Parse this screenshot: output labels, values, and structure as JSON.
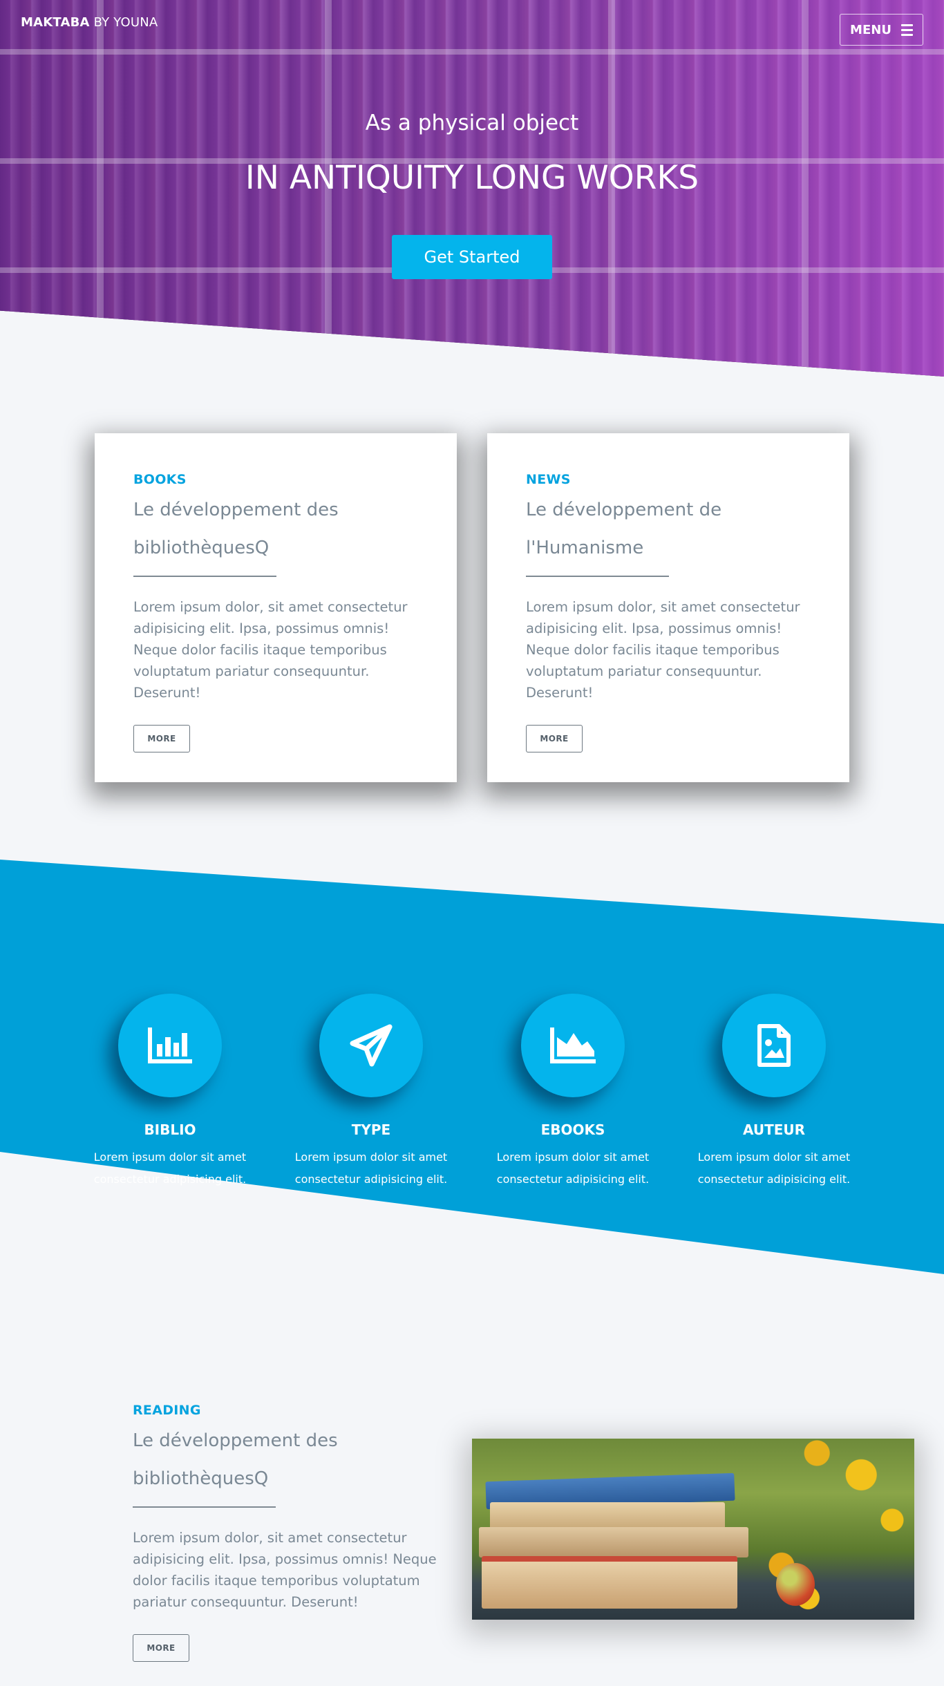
{
  "header": {
    "brand_bold": "MAKTABA",
    "brand_rest": " BY YOUNA",
    "menu_label": "MENU"
  },
  "hero": {
    "subtitle": "As a physical object",
    "title": "IN ANTIQUITY LONG WORKS",
    "cta_label": "Get Started"
  },
  "cards": [
    {
      "kicker": "BOOKS",
      "title_line1": "Le développement des",
      "title_line2": "bibliothèquesQ",
      "text": "Lorem ipsum dolor, sit amet consectetur adipisicing elit. Ipsa, possimus omnis! Neque dolor facilis itaque temporibus voluptatum pariatur consequuntur. Deserunt!",
      "button": "MORE"
    },
    {
      "kicker": "NEWS",
      "title_line1": "Le développement de",
      "title_line2": "l'Humanisme",
      "text": "Lorem ipsum dolor, sit amet consectetur adipisicing elit. Ipsa, possimus omnis! Neque dolor facilis itaque temporibus voluptatum pariatur consequuntur. Deserunt!",
      "button": "MORE"
    }
  ],
  "features": [
    {
      "icon": "bar-chart-icon",
      "title": "BIBLIO",
      "line1": "Lorem ipsum dolor sit amet",
      "line2": "consectetur adipisicing elit."
    },
    {
      "icon": "paper-plane-icon",
      "title": "TYPE",
      "line1": "Lorem ipsum dolor sit amet",
      "line2": "consectetur adipisicing elit."
    },
    {
      "icon": "area-chart-icon",
      "title": "EBOOKS",
      "line1": "Lorem ipsum dolor sit amet",
      "line2": "consectetur adipisicing elit."
    },
    {
      "icon": "file-image-icon",
      "title": "AUTEUR",
      "line1": "Lorem ipsum dolor sit amet",
      "line2": "consectetur adipisicing elit."
    }
  ],
  "reading": {
    "kicker": "READING",
    "title_line1": "Le développement des",
    "title_line2": "bibliothèquesQ",
    "text": "Lorem ipsum dolor, sit amet consectetur adipisicing elit. Ipsa, possimus omnis! Neque dolor facilis itaque temporibus voluptatum pariatur consequuntur. Deserunt!",
    "button": "MORE"
  },
  "colors": {
    "accent": "#04b4ec",
    "band": "#00a0d8",
    "hero_overlay": "#8c3ab4",
    "page_bg": "#f4f6f9"
  }
}
